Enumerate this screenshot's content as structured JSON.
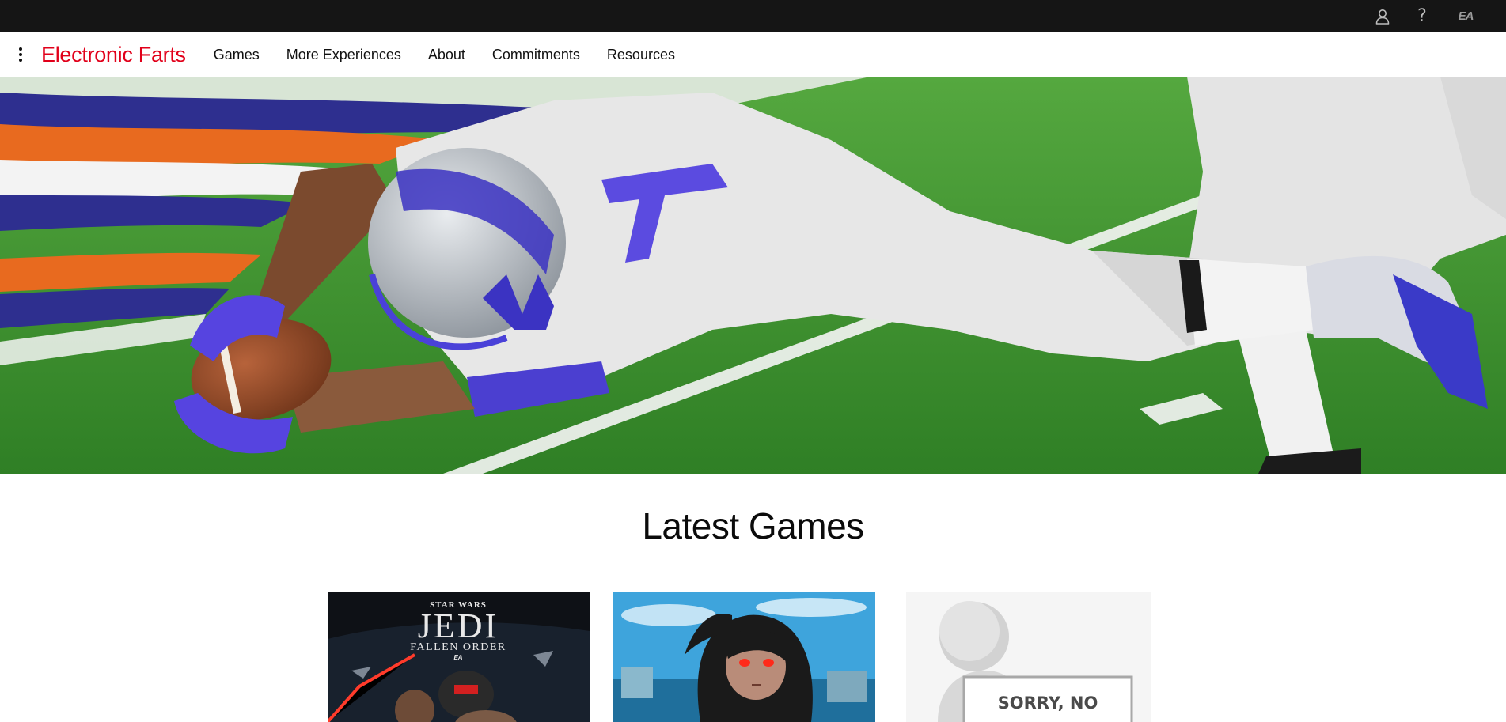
{
  "utility_bar": {
    "icons": [
      "user-icon",
      "help-icon",
      "ea-logo"
    ],
    "help_glyph": "?",
    "logo_text": "EA"
  },
  "nav": {
    "menu_icon": "kebab-menu-icon",
    "brand": "Electronic Farts",
    "links": [
      "Games",
      "More Experiences",
      "About",
      "Commitments",
      "Resources"
    ]
  },
  "hero": {
    "image": "football player diving with ball"
  },
  "latest_games": {
    "title": "Latest Games",
    "cards": [
      {
        "top_text": "STAR WARS",
        "title": "JEDI",
        "subtitle": "FALLEN ORDER",
        "publisher": "EA"
      },
      {
        "image": "dark-haired girl with glowing red eyes"
      },
      {
        "sign_text": "SORRY, NO"
      }
    ]
  },
  "colors": {
    "brand_red": "#e1001a",
    "utility_bar_bg": "#151515"
  }
}
